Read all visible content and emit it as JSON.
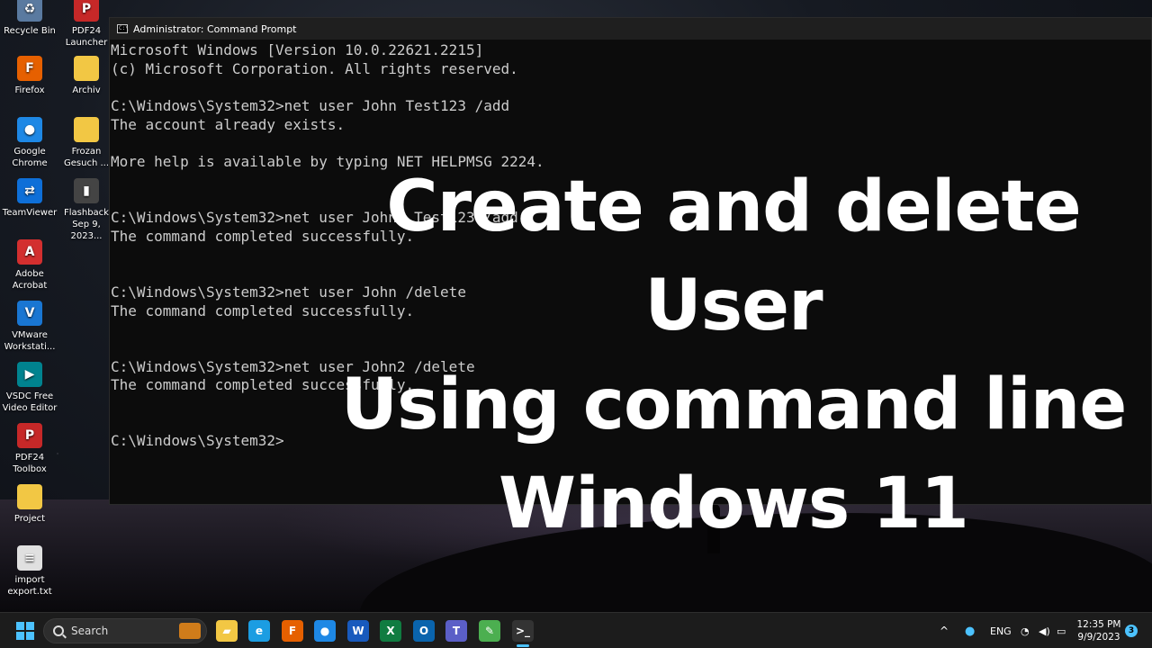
{
  "desktop": {
    "icons": [
      {
        "label": "Recycle Bin",
        "glyph": "♻",
        "color": "#5a7aa0"
      },
      {
        "label": "PDF24 Launcher",
        "glyph": "P",
        "color": "#c62828"
      },
      {
        "label": "Firefox",
        "glyph": "F",
        "color": "#e66000"
      },
      {
        "label": "Archiv",
        "glyph": "",
        "color": "#f2c744"
      },
      {
        "label": "Google Chrome",
        "glyph": "●",
        "color": "#1e88e5"
      },
      {
        "label": "Frozan Gesuch ...",
        "glyph": "",
        "color": "#f2c744"
      },
      {
        "label": "TeamViewer",
        "glyph": "⇄",
        "color": "#0e6fd8"
      },
      {
        "label": "Flashback Sep 9, 2023...",
        "glyph": "▮",
        "color": "#444"
      },
      {
        "label": "Adobe Acrobat",
        "glyph": "A",
        "color": "#d32f2f"
      },
      {
        "label": "VMware Workstati...",
        "glyph": "V",
        "color": "#1976d2"
      },
      {
        "label": "VSDC Free Video Editor",
        "glyph": "▶",
        "color": "#00838f"
      },
      {
        "label": "PDF24 Toolbox",
        "glyph": "P",
        "color": "#c62828"
      },
      {
        "label": "Project",
        "glyph": "",
        "color": "#f2c744"
      },
      {
        "label": "import export.txt",
        "glyph": "≡",
        "color": "#e0e0e0"
      }
    ]
  },
  "cmd": {
    "title": "Administrator: Command Prompt",
    "lines": [
      "Microsoft Windows [Version 10.0.22621.2215]",
      "(c) Microsoft Corporation. All rights reserved.",
      "",
      "C:\\Windows\\System32>net user John Test123 /add",
      "The account already exists.",
      "",
      "More help is available by typing NET HELPMSG 2224.",
      "",
      "",
      "C:\\Windows\\System32>net user John2 Test123 /add",
      "The command completed successfully.",
      "",
      "",
      "C:\\Windows\\System32>net user John /delete",
      "The command completed successfully.",
      "",
      "",
      "C:\\Windows\\System32>net user John2 /delete",
      "The command completed successfully.",
      "",
      "",
      "C:\\Windows\\System32>"
    ]
  },
  "overlay": {
    "line1": "Create and delete User",
    "line2": "Using command line",
    "line3": "Windows 11"
  },
  "taskbar": {
    "search_label": "Search",
    "apps": [
      {
        "name": "file-explorer-icon",
        "glyph": "▰",
        "color": "#f2c744"
      },
      {
        "name": "edge-icon",
        "glyph": "e",
        "color": "#1b9de2"
      },
      {
        "name": "firefox-icon",
        "glyph": "F",
        "color": "#e66000"
      },
      {
        "name": "chrome-icon",
        "glyph": "●",
        "color": "#1e88e5"
      },
      {
        "name": "word-icon",
        "glyph": "W",
        "color": "#185abd"
      },
      {
        "name": "excel-icon",
        "glyph": "X",
        "color": "#107c41"
      },
      {
        "name": "outlook-icon",
        "glyph": "O",
        "color": "#0a64ad"
      },
      {
        "name": "teams-icon",
        "glyph": "T",
        "color": "#5b5fc7"
      },
      {
        "name": "notepad-icon",
        "glyph": "✎",
        "color": "#4caf50"
      },
      {
        "name": "terminal-icon",
        "glyph": ">_",
        "color": "#333"
      }
    ],
    "tray": {
      "language": "ENG",
      "time": "12:35 PM",
      "date": "9/9/2023",
      "notifications": "3"
    }
  }
}
